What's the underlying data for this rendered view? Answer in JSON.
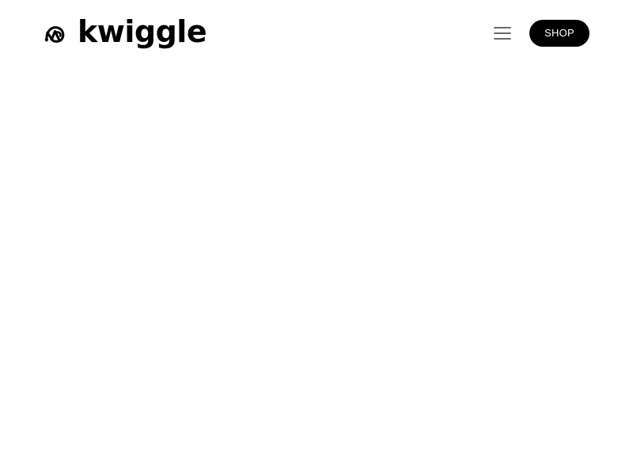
{
  "header": {
    "logo": {
      "text": "kwiggle",
      "icon": "kwiggle-bike-icon"
    },
    "menu": {
      "icon": "hamburger-menu-icon"
    },
    "shop_label": "SHOP"
  },
  "colors": {
    "background": "#ffffff",
    "text": "#000000",
    "button_background": "#000000",
    "button_text": "#ffffff",
    "menu_icon": "#555555"
  }
}
